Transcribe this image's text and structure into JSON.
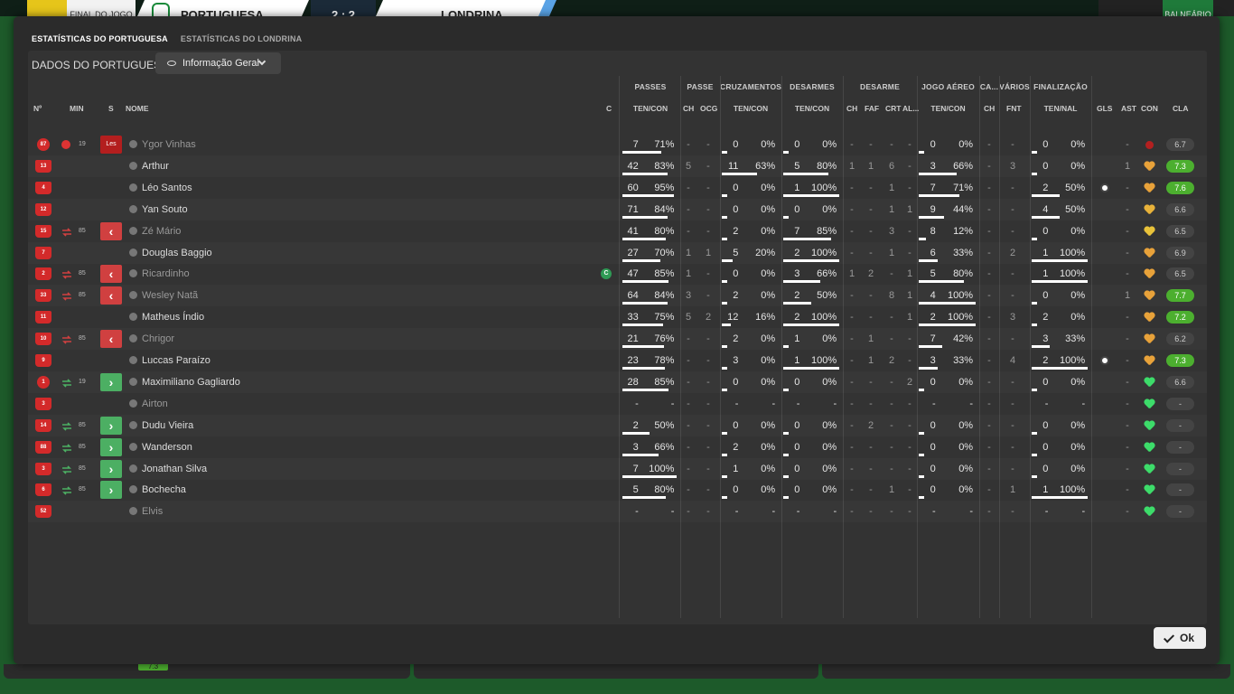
{
  "scoreboard": {
    "status": "FINAL DO JOGO",
    "home_team": "PORTUGUESA",
    "score": "2 : 2",
    "away_team": "LONDRINA",
    "button": "BALNEÁRIO"
  },
  "tabs": [
    {
      "label": "ESTATÍSTICAS DO PORTUGUESA",
      "active": true
    },
    {
      "label": "ESTATÍSTICAS DO LONDRINA",
      "active": false
    }
  ],
  "section_label": "DADOS DO PORTUGUESA",
  "view_dropdown": {
    "icon": "eye-icon",
    "value": "Informação Geral"
  },
  "group_headers": {
    "passes": "PASSES",
    "passe": "PASSE",
    "cruzamentos": "CRUZAMENTOS",
    "desarmes": "DESARMES",
    "desarme": "DESARME",
    "jogo_aereo": "JOGO AÉREO",
    "ca": "CA...",
    "varios": "VÁRIOS",
    "finalizacao": "FINALIZAÇÃO"
  },
  "col_headers": {
    "no": "Nº",
    "min": "MIN",
    "s": "S",
    "nome": "NOME",
    "c": "C",
    "passes_ten_con": "TEN/CON",
    "passe_ch": "CH",
    "passe_ocg": "OCG",
    "cruz_ten_con": "TEN/CON",
    "des_ten_con": "TEN/CON",
    "desarme_ch": "CH",
    "desarme_faf": "FAF",
    "desarme_crt": "CRT",
    "desarme_al": "AL...",
    "aereo_ten_con": "TEN/CON",
    "ca_ch": "CH",
    "varios_fnt": "FNT",
    "fin_ten_nal": "TEN/NAL",
    "gls": "GLS",
    "ast": "AST",
    "con": "CON",
    "cla": "CLA"
  },
  "players": [
    {
      "num": "87",
      "gk": true,
      "mark": "injury",
      "min": "19",
      "status": "Les",
      "name": "Ygor Vinhas",
      "dim": true,
      "pass": [
        "7",
        "71%"
      ],
      "pass_pct": 0.71,
      "ch": "-",
      "ocg": "-",
      "cruz": [
        "0",
        "0%"
      ],
      "cruz_pct": 0,
      "des": [
        "0",
        "0%"
      ],
      "des_pct": 0,
      "d_ch": "-",
      "faf": "-",
      "crt": "-",
      "al": "-",
      "aer": [
        "0",
        "0%"
      ],
      "aer_pct": 0,
      "ca": "-",
      "fnt": "-",
      "fin": [
        "0",
        "0%"
      ],
      "fin_pct": 0,
      "gls": "",
      "ast": "-",
      "con": "red",
      "cla": "6.7",
      "cla_good": false
    },
    {
      "num": "13",
      "gk": false,
      "mark": "",
      "min": "",
      "status": "",
      "name": "Arthur",
      "dim": false,
      "pass": [
        "42",
        "83%"
      ],
      "pass_pct": 0.83,
      "ch": "5",
      "ocg": "-",
      "cruz": [
        "11",
        "63%"
      ],
      "cruz_pct": 0.63,
      "des": [
        "5",
        "80%"
      ],
      "des_pct": 0.8,
      "d_ch": "1",
      "faf": "1",
      "crt": "6",
      "al": "-",
      "aer": [
        "3",
        "66%"
      ],
      "aer_pct": 0.66,
      "ca": "-",
      "fnt": "3",
      "fin": [
        "0",
        "0%"
      ],
      "fin_pct": 0,
      "gls": "",
      "ast": "1",
      "con": "#e8a23a",
      "cla": "7.3",
      "cla_good": true
    },
    {
      "num": "4",
      "gk": false,
      "mark": "",
      "min": "",
      "status": "",
      "name": "Léo Santos",
      "dim": false,
      "pass": [
        "60",
        "95%"
      ],
      "pass_pct": 0.95,
      "ch": "-",
      "ocg": "-",
      "cruz": [
        "0",
        "0%"
      ],
      "cruz_pct": 0,
      "des": [
        "1",
        "100%"
      ],
      "des_pct": 1,
      "d_ch": "-",
      "faf": "-",
      "crt": "1",
      "al": "-",
      "aer": [
        "7",
        "71%"
      ],
      "aer_pct": 0.71,
      "ca": "-",
      "fnt": "-",
      "fin": [
        "2",
        "50%"
      ],
      "fin_pct": 0.5,
      "gls": "ball",
      "ast": "-",
      "con": "#e8a23a",
      "cla": "7.6",
      "cla_good": true
    },
    {
      "num": "12",
      "gk": false,
      "mark": "",
      "min": "",
      "status": "",
      "name": "Yan Souto",
      "dim": false,
      "pass": [
        "71",
        "84%"
      ],
      "pass_pct": 0.84,
      "ch": "-",
      "ocg": "-",
      "cruz": [
        "0",
        "0%"
      ],
      "cruz_pct": 0,
      "des": [
        "0",
        "0%"
      ],
      "des_pct": 0,
      "d_ch": "-",
      "faf": "-",
      "crt": "1",
      "al": "1",
      "aer": [
        "9",
        "44%"
      ],
      "aer_pct": 0.44,
      "ca": "-",
      "fnt": "-",
      "fin": [
        "4",
        "50%"
      ],
      "fin_pct": 0.5,
      "gls": "",
      "ast": "-",
      "con": "#e8b23a",
      "cla": "6.6",
      "cla_good": false
    },
    {
      "num": "15",
      "gk": false,
      "mark": "sub",
      "min": "85",
      "status": "out",
      "name": "Zé Mário",
      "dim": true,
      "pass": [
        "41",
        "80%"
      ],
      "pass_pct": 0.8,
      "ch": "-",
      "ocg": "-",
      "cruz": [
        "2",
        "0%"
      ],
      "cruz_pct": 0,
      "des": [
        "7",
        "85%"
      ],
      "des_pct": 0.85,
      "d_ch": "-",
      "faf": "-",
      "crt": "3",
      "al": "-",
      "aer": [
        "8",
        "12%"
      ],
      "aer_pct": 0.12,
      "ca": "-",
      "fnt": "-",
      "fin": [
        "0",
        "0%"
      ],
      "fin_pct": 0,
      "gls": "",
      "ast": "-",
      "con": "#e8c23a",
      "cla": "6.5",
      "cla_good": false
    },
    {
      "num": "7",
      "gk": false,
      "mark": "",
      "min": "",
      "status": "",
      "name": "Douglas Baggio",
      "dim": false,
      "pass": [
        "27",
        "70%"
      ],
      "pass_pct": 0.7,
      "ch": "1",
      "ocg": "1",
      "cruz": [
        "5",
        "20%"
      ],
      "cruz_pct": 0.2,
      "des": [
        "2",
        "100%"
      ],
      "des_pct": 1,
      "d_ch": "-",
      "faf": "-",
      "crt": "1",
      "al": "-",
      "aer": [
        "6",
        "33%"
      ],
      "aer_pct": 0.33,
      "ca": "-",
      "fnt": "2",
      "fin": [
        "1",
        "100%"
      ],
      "fin_pct": 1,
      "gls": "",
      "ast": "-",
      "con": "#e8a23a",
      "cla": "6.9",
      "cla_good": false
    },
    {
      "num": "2",
      "gk": false,
      "mark": "sub",
      "min": "85",
      "status": "out",
      "name": "Ricardinho",
      "dim": true,
      "captain": true,
      "pass": [
        "47",
        "85%"
      ],
      "pass_pct": 0.85,
      "ch": "1",
      "ocg": "-",
      "cruz": [
        "0",
        "0%"
      ],
      "cruz_pct": 0,
      "des": [
        "3",
        "66%"
      ],
      "des_pct": 0.66,
      "d_ch": "1",
      "faf": "2",
      "crt": "-",
      "al": "1",
      "aer": [
        "5",
        "80%"
      ],
      "aer_pct": 0.8,
      "ca": "-",
      "fnt": "-",
      "fin": [
        "1",
        "100%"
      ],
      "fin_pct": 1,
      "gls": "",
      "ast": "-",
      "con": "#e8a23a",
      "cla": "6.5",
      "cla_good": false
    },
    {
      "num": "33",
      "gk": false,
      "mark": "sub",
      "min": "85",
      "status": "out",
      "name": "Wesley Natã",
      "dim": true,
      "pass": [
        "64",
        "84%"
      ],
      "pass_pct": 0.84,
      "ch": "3",
      "ocg": "-",
      "cruz": [
        "2",
        "0%"
      ],
      "cruz_pct": 0,
      "des": [
        "2",
        "50%"
      ],
      "des_pct": 0.5,
      "d_ch": "-",
      "faf": "-",
      "crt": "8",
      "al": "1",
      "aer": [
        "4",
        "100%"
      ],
      "aer_pct": 1,
      "ca": "-",
      "fnt": "-",
      "fin": [
        "0",
        "0%"
      ],
      "fin_pct": 0,
      "gls": "",
      "ast": "1",
      "con": "#e8a23a",
      "cla": "7.7",
      "cla_good": true
    },
    {
      "num": "11",
      "gk": false,
      "mark": "",
      "min": "",
      "status": "",
      "name": "Matheus Índio",
      "dim": false,
      "pass": [
        "33",
        "75%"
      ],
      "pass_pct": 0.75,
      "ch": "5",
      "ocg": "2",
      "cruz": [
        "12",
        "16%"
      ],
      "cruz_pct": 0.16,
      "des": [
        "2",
        "100%"
      ],
      "des_pct": 1,
      "d_ch": "-",
      "faf": "-",
      "crt": "-",
      "al": "1",
      "aer": [
        "2",
        "100%"
      ],
      "aer_pct": 1,
      "ca": "-",
      "fnt": "3",
      "fin": [
        "2",
        "0%"
      ],
      "fin_pct": 0,
      "gls": "",
      "ast": "-",
      "con": "#e8a23a",
      "cla": "7.2",
      "cla_good": true
    },
    {
      "num": "10",
      "gk": false,
      "mark": "sub",
      "min": "85",
      "status": "out",
      "name": "Chrigor",
      "dim": true,
      "pass": [
        "21",
        "76%"
      ],
      "pass_pct": 0.76,
      "ch": "-",
      "ocg": "-",
      "cruz": [
        "2",
        "0%"
      ],
      "cruz_pct": 0,
      "des": [
        "1",
        "0%"
      ],
      "des_pct": 0,
      "d_ch": "-",
      "faf": "1",
      "crt": "-",
      "al": "-",
      "aer": [
        "7",
        "42%"
      ],
      "aer_pct": 0.42,
      "ca": "-",
      "fnt": "-",
      "fin": [
        "3",
        "33%"
      ],
      "fin_pct": 0.33,
      "gls": "",
      "ast": "-",
      "con": "#e8a23a",
      "cla": "6.2",
      "cla_good": false
    },
    {
      "num": "9",
      "gk": false,
      "mark": "",
      "min": "",
      "status": "",
      "name": "Luccas Paraízo",
      "dim": false,
      "pass": [
        "23",
        "78%"
      ],
      "pass_pct": 0.78,
      "ch": "-",
      "ocg": "-",
      "cruz": [
        "3",
        "0%"
      ],
      "cruz_pct": 0,
      "des": [
        "1",
        "100%"
      ],
      "des_pct": 1,
      "d_ch": "-",
      "faf": "1",
      "crt": "2",
      "al": "-",
      "aer": [
        "3",
        "33%"
      ],
      "aer_pct": 0.33,
      "ca": "-",
      "fnt": "4",
      "fin": [
        "2",
        "100%"
      ],
      "fin_pct": 1,
      "gls": "ball",
      "ast": "-",
      "con": "#e8a23a",
      "cla": "7.3",
      "cla_good": true
    },
    {
      "num": "1",
      "gk": true,
      "mark": "sub",
      "min": "19",
      "status": "in",
      "name": "Maximiliano Gagliardo",
      "dim": false,
      "pass": [
        "28",
        "85%"
      ],
      "pass_pct": 0.85,
      "ch": "-",
      "ocg": "-",
      "cruz": [
        "0",
        "0%"
      ],
      "cruz_pct": 0,
      "des": [
        "0",
        "0%"
      ],
      "des_pct": 0,
      "d_ch": "-",
      "faf": "-",
      "crt": "-",
      "al": "2",
      "aer": [
        "0",
        "0%"
      ],
      "aer_pct": 0,
      "ca": "-",
      "fnt": "-",
      "fin": [
        "0",
        "0%"
      ],
      "fin_pct": 0,
      "gls": "",
      "ast": "-",
      "con": "#3ddc6a",
      "cla": "6.6",
      "cla_good": false
    },
    {
      "num": "3",
      "gk": false,
      "mark": "",
      "min": "",
      "status": "",
      "name": "Airton",
      "dim": true,
      "pass": [
        "-",
        "-"
      ],
      "pass_pct": 0,
      "ch": "-",
      "ocg": "-",
      "cruz": [
        "-",
        "-"
      ],
      "cruz_pct": 0,
      "des": [
        "-",
        "-"
      ],
      "des_pct": 0,
      "d_ch": "-",
      "faf": "-",
      "crt": "-",
      "al": "-",
      "aer": [
        "-",
        "-"
      ],
      "aer_pct": 0,
      "ca": "-",
      "fnt": "-",
      "fin": [
        "-",
        "-"
      ],
      "fin_pct": 0,
      "gls": "",
      "ast": "-",
      "con": "#3ddc6a",
      "cla": "-",
      "cla_good": false
    },
    {
      "num": "14",
      "gk": false,
      "mark": "sub",
      "min": "85",
      "status": "in",
      "name": "Dudu Vieira",
      "dim": false,
      "pass": [
        "2",
        "50%"
      ],
      "pass_pct": 0.5,
      "ch": "-",
      "ocg": "-",
      "cruz": [
        "0",
        "0%"
      ],
      "cruz_pct": 0,
      "des": [
        "0",
        "0%"
      ],
      "des_pct": 0,
      "d_ch": "-",
      "faf": "2",
      "crt": "-",
      "al": "-",
      "aer": [
        "0",
        "0%"
      ],
      "aer_pct": 0,
      "ca": "-",
      "fnt": "-",
      "fin": [
        "0",
        "0%"
      ],
      "fin_pct": 0,
      "gls": "",
      "ast": "-",
      "con": "#3ddc6a",
      "cla": "-",
      "cla_good": false
    },
    {
      "num": "88",
      "gk": false,
      "mark": "sub",
      "min": "85",
      "status": "in",
      "name": "Wanderson",
      "dim": false,
      "pass": [
        "3",
        "66%"
      ],
      "pass_pct": 0.66,
      "ch": "-",
      "ocg": "-",
      "cruz": [
        "2",
        "0%"
      ],
      "cruz_pct": 0,
      "des": [
        "0",
        "0%"
      ],
      "des_pct": 0,
      "d_ch": "-",
      "faf": "-",
      "crt": "-",
      "al": "-",
      "aer": [
        "0",
        "0%"
      ],
      "aer_pct": 0,
      "ca": "-",
      "fnt": "-",
      "fin": [
        "0",
        "0%"
      ],
      "fin_pct": 0,
      "gls": "",
      "ast": "-",
      "con": "#3ddc6a",
      "cla": "-",
      "cla_good": false
    },
    {
      "num": "3",
      "gk": false,
      "mark": "sub",
      "min": "85",
      "status": "in",
      "name": "Jonathan Silva",
      "dim": false,
      "pass": [
        "7",
        "100%"
      ],
      "pass_pct": 1,
      "ch": "-",
      "ocg": "-",
      "cruz": [
        "1",
        "0%"
      ],
      "cruz_pct": 0,
      "des": [
        "0",
        "0%"
      ],
      "des_pct": 0,
      "d_ch": "-",
      "faf": "-",
      "crt": "-",
      "al": "-",
      "aer": [
        "0",
        "0%"
      ],
      "aer_pct": 0,
      "ca": "-",
      "fnt": "-",
      "fin": [
        "0",
        "0%"
      ],
      "fin_pct": 0,
      "gls": "",
      "ast": "-",
      "con": "#3ddc6a",
      "cla": "-",
      "cla_good": false
    },
    {
      "num": "6",
      "gk": false,
      "mark": "sub",
      "min": "85",
      "status": "in",
      "name": "Bochecha",
      "dim": false,
      "pass": [
        "5",
        "80%"
      ],
      "pass_pct": 0.8,
      "ch": "-",
      "ocg": "-",
      "cruz": [
        "0",
        "0%"
      ],
      "cruz_pct": 0,
      "des": [
        "0",
        "0%"
      ],
      "des_pct": 0,
      "d_ch": "-",
      "faf": "-",
      "crt": "1",
      "al": "-",
      "aer": [
        "0",
        "0%"
      ],
      "aer_pct": 0,
      "ca": "-",
      "fnt": "1",
      "fin": [
        "1",
        "100%"
      ],
      "fin_pct": 1,
      "gls": "",
      "ast": "-",
      "con": "#3ddc6a",
      "cla": "-",
      "cla_good": false
    },
    {
      "num": "52",
      "gk": false,
      "mark": "",
      "min": "",
      "status": "",
      "name": "Elvis",
      "dim": true,
      "pass": [
        "-",
        "-"
      ],
      "pass_pct": 0,
      "ch": "-",
      "ocg": "-",
      "cruz": [
        "-",
        "-"
      ],
      "cruz_pct": 0,
      "des": [
        "-",
        "-"
      ],
      "des_pct": 0,
      "d_ch": "-",
      "faf": "-",
      "crt": "-",
      "al": "-",
      "aer": [
        "-",
        "-"
      ],
      "aer_pct": 0,
      "ca": "-",
      "fnt": "-",
      "fin": [
        "-",
        "-"
      ],
      "fin_pct": 0,
      "gls": "",
      "ast": "-",
      "con": "#3ddc6a",
      "cla": "-",
      "cla_good": false
    }
  ],
  "ok_button": "Ok",
  "background_rating": "7.3"
}
